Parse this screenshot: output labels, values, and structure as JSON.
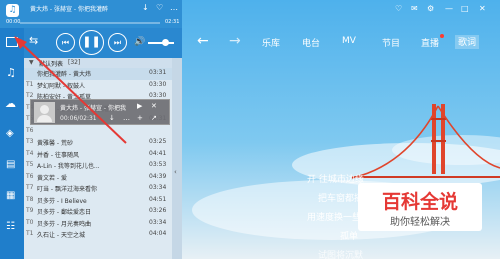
{
  "player": {
    "now_playing": "黄大炜 - 张赫宣 - 你把我灌醉",
    "time_current": "00:00",
    "time_total": "02:31"
  },
  "nav": {
    "tabs": [
      "乐库",
      "电台",
      "MV",
      "节目",
      "直播",
      "歌词"
    ]
  },
  "playlist": {
    "header_label": "默认列表",
    "header_count": "[32]",
    "items": [
      {
        "no": "",
        "title": "你把我灌醉 - 黄大炜",
        "dur": "03:31"
      },
      {
        "no": "T1",
        "title": "梦幻阿默 - 叙鼓人",
        "dur": "03:30"
      },
      {
        "no": "T2",
        "title": "陈柏安好 - 黄士孤草",
        "dur": "03:30"
      },
      {
        "no": "T4",
        "title": "黄大炜 - 张赫宣 - 你把我灌醉",
        "dur": ""
      },
      {
        "no": "T5",
        "title": "",
        "dur": "02:31"
      },
      {
        "no": "T6",
        "title": "",
        "dur": ""
      },
      {
        "no": "T3",
        "title": "黄雅馨 - 荒砂",
        "dur": "03:25"
      },
      {
        "no": "T4",
        "title": "并香 - 往事随风",
        "dur": "04:41"
      },
      {
        "no": "T5",
        "title": "A-Lin - 我等到花儿也...",
        "dur": "03:53"
      },
      {
        "no": "T6",
        "title": "黄文若 - 爱",
        "dur": "04:39"
      },
      {
        "no": "T7",
        "title": "叮当 - 飘洋过海来看你",
        "dur": "03:34"
      },
      {
        "no": "T8",
        "title": "贝多芬 - I Believe",
        "dur": "04:51"
      },
      {
        "no": "T9",
        "title": "贝多芬 - 鄱绘爱恋日",
        "dur": "03:26"
      },
      {
        "no": "T0",
        "title": "贝多芬 - 月光奏鸣曲",
        "dur": "03:34"
      },
      {
        "no": "T1",
        "title": "久石让 - 天空之城",
        "dur": "04:04"
      }
    ]
  },
  "popup": {
    "line1": "黄大炜 - 张赫宣 - 你把我",
    "line2": "00:06/02:31"
  },
  "scene_text": {
    "line1": "开 往城市边缘",
    "line2": "把车窗都摇",
    "line3": "用速度换一些",
    "line4": "孤单",
    "line5": "试图将沉默"
  },
  "watermark": {
    "title": "百科全说",
    "subtitle": "助你轻松解决"
  },
  "colors": {
    "accent": "#2a88d0",
    "annotation_arrow": "#e53935",
    "watermark_bg": "#ffffff",
    "watermark_title": "#e53935"
  }
}
